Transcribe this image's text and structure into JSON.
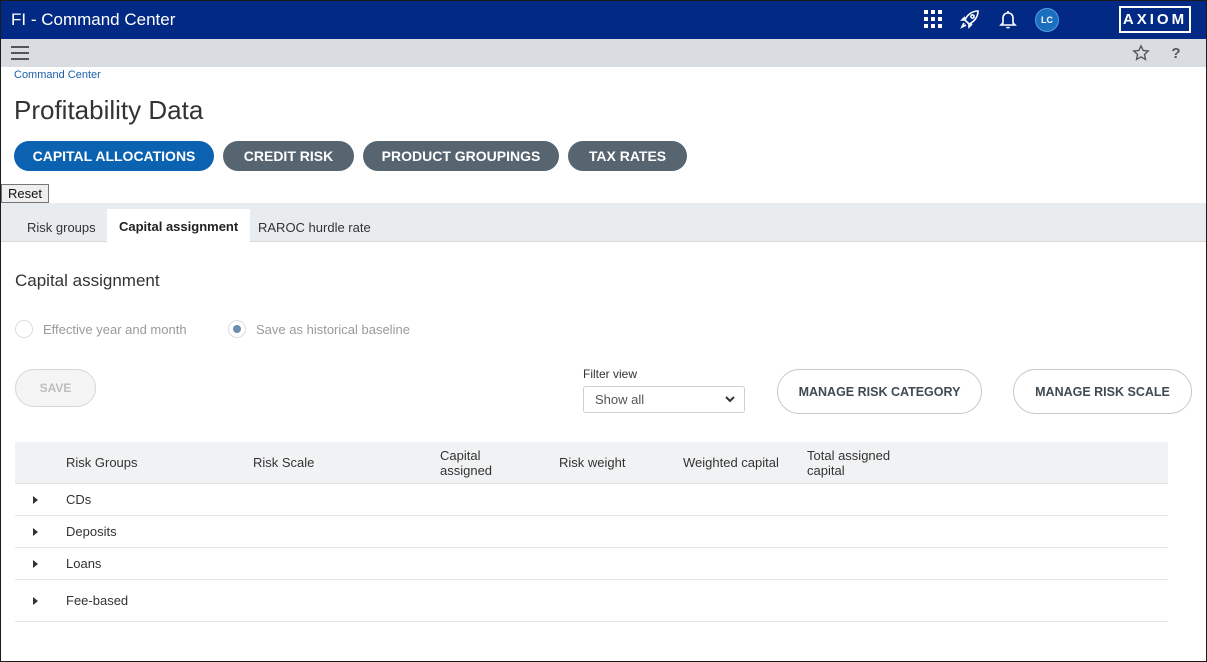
{
  "app": {
    "title": "FI - Command Center",
    "logo": "AXIOM",
    "user_initials": "LC"
  },
  "topbar_icons": [
    "apps-grid-icon",
    "rocket-icon",
    "bell-icon"
  ],
  "subbar_icons": [
    "menu-icon",
    "star-icon",
    "help-icon"
  ],
  "help_label": "?",
  "breadcrumb": "Command Center",
  "page_title": "Profitability Data",
  "nav_pills": [
    {
      "label": "CAPITAL ALLOCATIONS",
      "active": true
    },
    {
      "label": "CREDIT RISK",
      "active": false
    },
    {
      "label": "PRODUCT GROUPINGS",
      "active": false
    },
    {
      "label": "TAX RATES",
      "active": false
    }
  ],
  "reset_label": "Reset",
  "tabs": [
    {
      "label": "Risk groups",
      "active": false
    },
    {
      "label": "Capital assignment",
      "active": true
    },
    {
      "label": "RAROC hurdle rate",
      "active": false
    }
  ],
  "section_title": "Capital assignment",
  "radios": [
    {
      "label": "Effective year and month",
      "selected": false
    },
    {
      "label": "Save as historical baseline",
      "selected": true
    }
  ],
  "save_label": "SAVE",
  "filter": {
    "label": "Filter view",
    "value": "Show all"
  },
  "buttons": {
    "manage_category": "MANAGE RISK CATEGORY",
    "manage_scale": "MANAGE RISK SCALE"
  },
  "table": {
    "columns": [
      "Risk Groups",
      "Risk Scale",
      "Capital assigned",
      "Risk weight",
      "Weighted capital",
      "Total assigned capital"
    ],
    "rows": [
      "CDs",
      "Deposits",
      "Loans",
      "Fee-based"
    ]
  },
  "colors": {
    "topbar": "#022a84",
    "accent": "#0a62b0",
    "pill_inactive": "#56656f"
  }
}
